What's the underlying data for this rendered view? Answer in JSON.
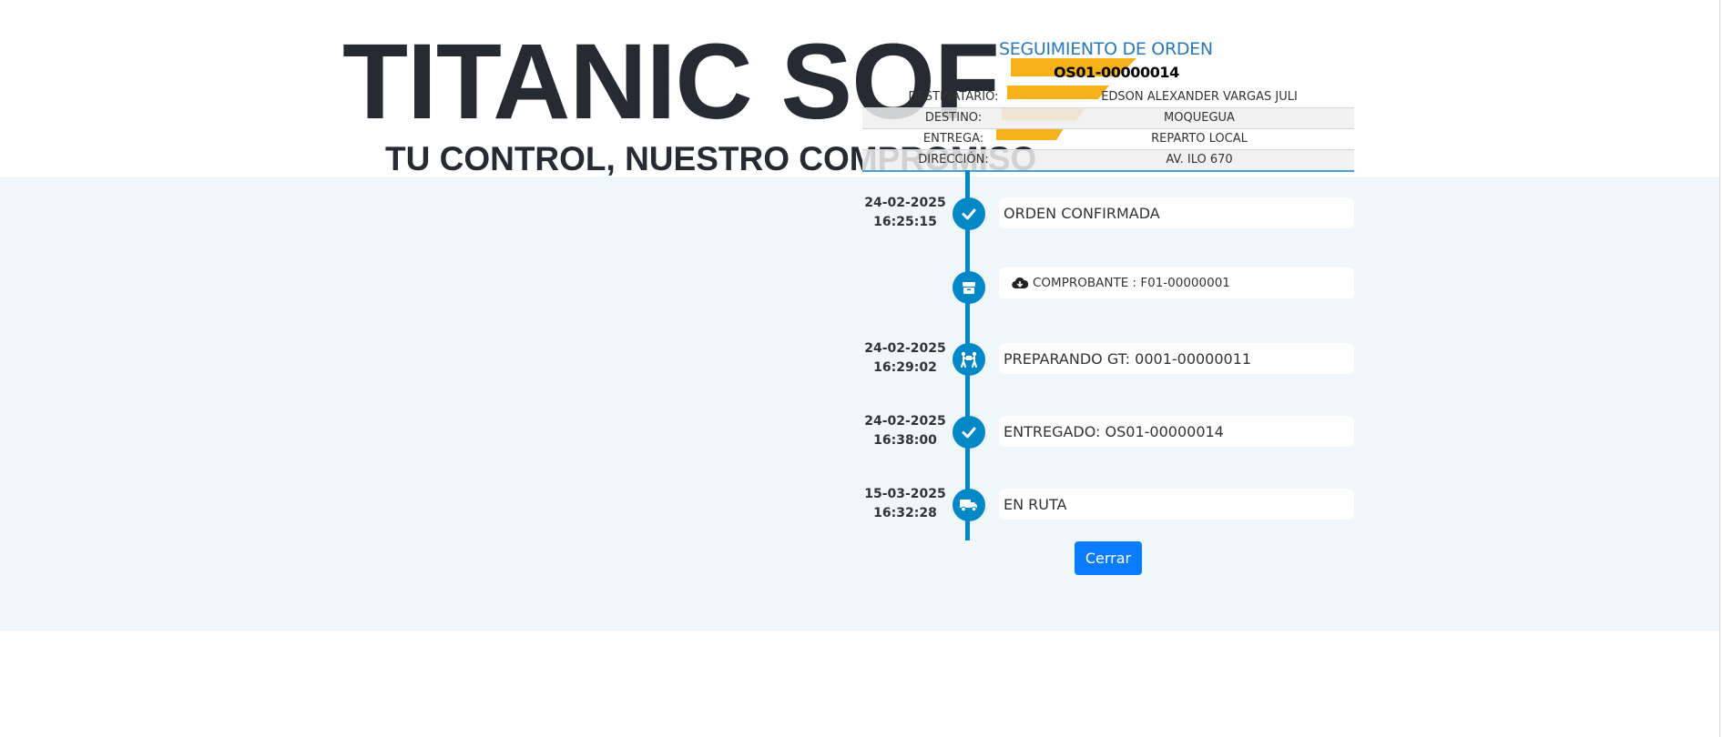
{
  "logo": {
    "main_text": "TITANIC SOF",
    "tagline": "TU CONTROL, NUESTRO COMPROMISO"
  },
  "panel": {
    "title": "SEGUIMIENTO DE ORDEN",
    "order_number": "OS01-00000014",
    "fields": [
      {
        "label": "DESTINATARIO:",
        "value": "EDSON ALEXANDER VARGAS JULI"
      },
      {
        "label": "DESTINO:",
        "value": "MOQUEGUA"
      },
      {
        "label": "ENTREGA:",
        "value": "REPARTO LOCAL"
      },
      {
        "label": "DIRECCIÓN:",
        "value": "AV. ILO 670"
      }
    ]
  },
  "timeline": [
    {
      "date": "24-02-2025",
      "time": "16:25:15",
      "icon": "check-icon",
      "text": "ORDEN CONFIRMADA"
    },
    {
      "date": "",
      "time": "",
      "icon": "box-icon",
      "text": "COMPROBANTE : F01-00000001",
      "sub_icon": "cloud-download-icon"
    },
    {
      "date": "24-02-2025",
      "time": "16:29:02",
      "icon": "people-carry-icon",
      "text": "PREPARANDO GT: 0001-00000011"
    },
    {
      "date": "24-02-2025",
      "time": "16:38:00",
      "icon": "check-icon",
      "text": "ENTREGADO: OS01-00000014"
    },
    {
      "date": "15-03-2025",
      "time": "16:32:28",
      "icon": "truck-icon",
      "text": "EN RUTA"
    }
  ],
  "close_button": {
    "label": "Cerrar"
  },
  "colors": {
    "accent": "#0288c7",
    "button": "#0b7cff",
    "title": "#2a7ab8",
    "band": "#eff7fa",
    "logo_dark": "#262a33",
    "logo_yellow": "#f7b21b"
  }
}
